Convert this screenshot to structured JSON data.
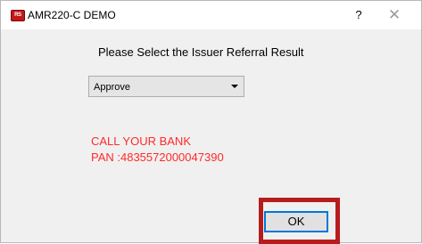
{
  "window": {
    "title": "AMR220-C DEMO",
    "icon_text": "RS",
    "help_label": "?",
    "close_label": "✕"
  },
  "dialog": {
    "prompt": "Please Select the Issuer Referral Result",
    "result_select": {
      "selected": "Approve"
    },
    "message_line1": "CALL YOUR BANK",
    "message_line2": "PAN :4835572000047390",
    "ok_label": "OK"
  },
  "colors": {
    "message_text": "#ff2a2a",
    "highlight_border": "#b71c1c",
    "ok_focus_border": "#0078d7"
  }
}
